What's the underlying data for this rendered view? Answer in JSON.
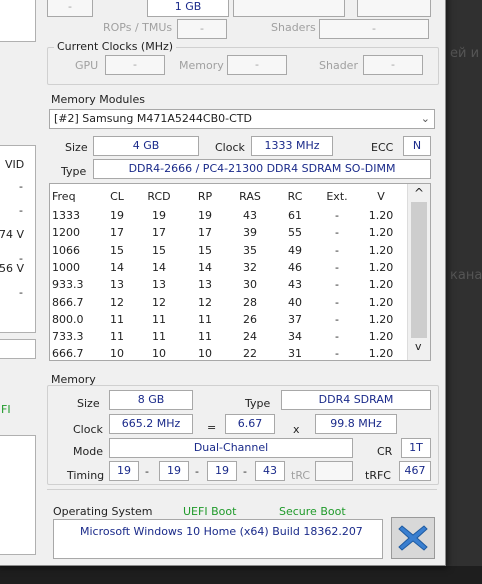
{
  "left_panel": {
    "vid_label": "VID",
    "vid_values": [
      "-",
      "-",
      "74 V",
      "-",
      "56 V",
      "-"
    ],
    "fi_text": "FI"
  },
  "gpu_partial": {
    "rops_label": "ROPs / TMUs",
    "rops_value": "-",
    "memory_partial": "1 GB",
    "shaders_label": "Shaders",
    "shaders_value": "-"
  },
  "current_clocks": {
    "title": "Current Clocks (MHz)",
    "gpu_label": "GPU",
    "gpu_value": "-",
    "memory_label": "Memory",
    "memory_value": "-",
    "shader_label": "Shader",
    "shader_value": "-"
  },
  "memory_modules": {
    "title": "Memory Modules",
    "selected_module": "[#2] Samsung M471A5244CB0-CTD",
    "size_label": "Size",
    "size_value": "4 GB",
    "clock_label": "Clock",
    "clock_value": "1333 MHz",
    "ecc_label": "ECC",
    "ecc_value": "N",
    "type_label": "Type",
    "type_value": "DDR4-2666 / PC4-21300 DDR4 SDRAM SO-DIMM",
    "timing_headers": [
      "Freq",
      "CL",
      "RCD",
      "RP",
      "RAS",
      "RC",
      "Ext.",
      "V"
    ],
    "timing_rows": [
      [
        "1333",
        "19",
        "19",
        "19",
        "43",
        "61",
        "-",
        "1.20"
      ],
      [
        "1200",
        "17",
        "17",
        "17",
        "39",
        "55",
        "-",
        "1.20"
      ],
      [
        "1066",
        "15",
        "15",
        "15",
        "35",
        "49",
        "-",
        "1.20"
      ],
      [
        "1000",
        "14",
        "14",
        "14",
        "32",
        "46",
        "-",
        "1.20"
      ],
      [
        "933.3",
        "13",
        "13",
        "13",
        "30",
        "43",
        "-",
        "1.20"
      ],
      [
        "866.7",
        "12",
        "12",
        "12",
        "28",
        "40",
        "-",
        "1.20"
      ],
      [
        "800.0",
        "11",
        "11",
        "11",
        "26",
        "37",
        "-",
        "1.20"
      ],
      [
        "733.3",
        "11",
        "11",
        "11",
        "24",
        "34",
        "-",
        "1.20"
      ],
      [
        "666.7",
        "10",
        "10",
        "10",
        "22",
        "31",
        "-",
        "1.20"
      ]
    ],
    "scroll_up": "^",
    "scroll_down": "v"
  },
  "memory": {
    "title": "Memory",
    "size_label": "Size",
    "size_value": "8 GB",
    "type_label": "Type",
    "type_value": "DDR4 SDRAM",
    "clock_label": "Clock",
    "clock_value": "665.2 MHz",
    "eq": "=",
    "multiplier": "6.67",
    "x": "x",
    "base_clock": "99.8 MHz",
    "mode_label": "Mode",
    "mode_value": "Dual-Channel",
    "cr_label": "CR",
    "cr_value": "1T",
    "timing_label": "Timing",
    "timing_values": [
      "19",
      "19",
      "19",
      "43"
    ],
    "dash": "-",
    "trc_label": "tRC",
    "trc_value": "",
    "trfc_label": "tRFC",
    "trfc_value": "467"
  },
  "os": {
    "label": "Operating System",
    "uefi": "UEFI Boot",
    "secure": "Secure Boot",
    "value": "Microsoft Windows 10 Home (x64) Build 18362.207"
  },
  "background": {
    "ghost1": "ей и",
    "ghost2": "кана"
  },
  "colors": {
    "value_text": "#1a2a8a",
    "green_text": "#1f9a2a",
    "close_blue": "#3a7fd0"
  }
}
